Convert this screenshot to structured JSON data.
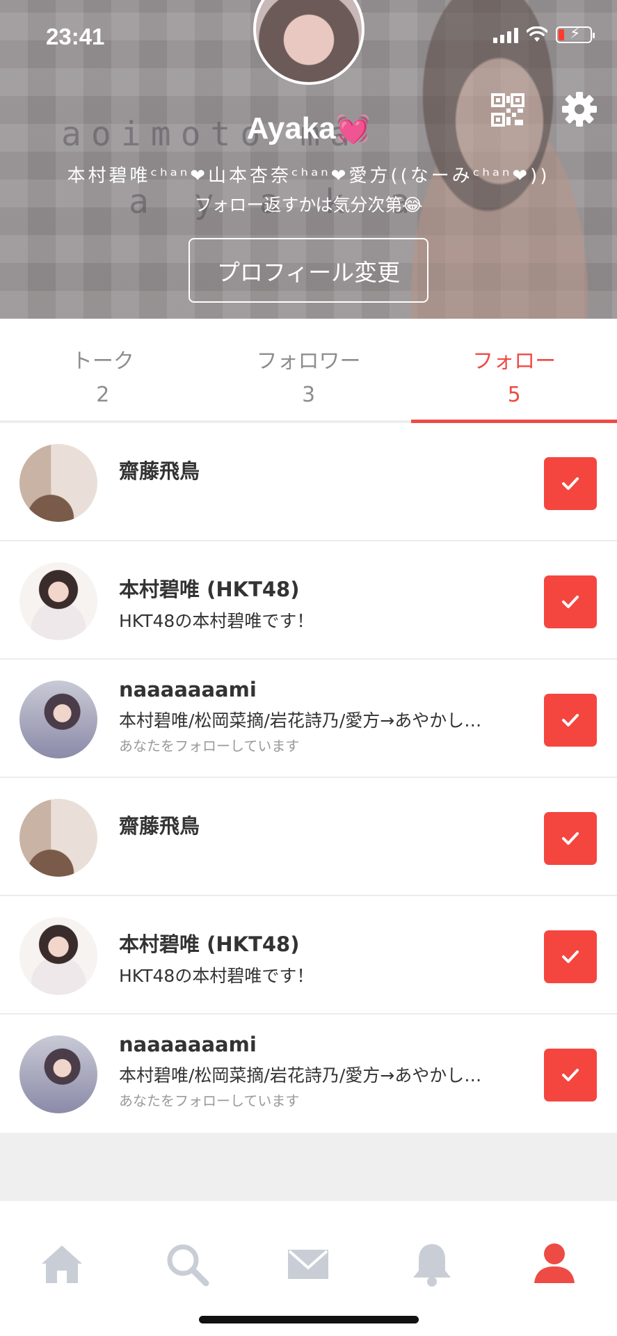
{
  "status_bar": {
    "time": "23:41"
  },
  "header": {
    "background_text_1": "aoimoto ma",
    "background_text_2": "a y a k a",
    "name": "Ayaka",
    "name_emoji": "💓",
    "bio_line_1": "本村碧唯ᶜʰᵃⁿ❤山本杏奈ᶜʰᵃⁿ❤愛方((なーみᶜʰᵃⁿ❤))",
    "bio_line_2": "フォロー返すかは気分次第😂",
    "edit_profile_label": "プロフィール変更"
  },
  "tabs": [
    {
      "label": "トーク",
      "count": "2",
      "active": false
    },
    {
      "label": "フォロワー",
      "count": "3",
      "active": false
    },
    {
      "label": "フォロー",
      "count": "5",
      "active": true
    }
  ],
  "follow_list": [
    {
      "name": "齋藤飛鳥",
      "description": "",
      "sub": ""
    },
    {
      "name": "本村碧唯 (HKT48)",
      "description": "HKT48の本村碧唯です！",
      "sub": ""
    },
    {
      "name": "naaaaaaami",
      "description": "本村碧唯/松岡菜摘/岩花詩乃/愛方→あやかし…",
      "sub": "あなたをフォローしています"
    },
    {
      "name": "齋藤飛鳥",
      "description": "",
      "sub": ""
    },
    {
      "name": "本村碧唯 (HKT48)",
      "description": "HKT48の本村碧唯です！",
      "sub": ""
    },
    {
      "name": "naaaaaaami",
      "description": "本村碧唯/松岡菜摘/岩花詩乃/愛方→あやかし…",
      "sub": "あなたをフォローしています"
    }
  ],
  "bottom_nav": [
    {
      "icon": "home-icon",
      "active": false
    },
    {
      "icon": "search-icon",
      "active": false
    },
    {
      "icon": "mail-icon",
      "active": false
    },
    {
      "icon": "bell-icon",
      "active": false
    },
    {
      "icon": "profile-icon",
      "active": true
    }
  ],
  "colors": {
    "accent": "#ee4b45",
    "inactive_icon": "#c9ced6",
    "text_primary": "#333333",
    "text_muted": "#8e8e8e"
  }
}
